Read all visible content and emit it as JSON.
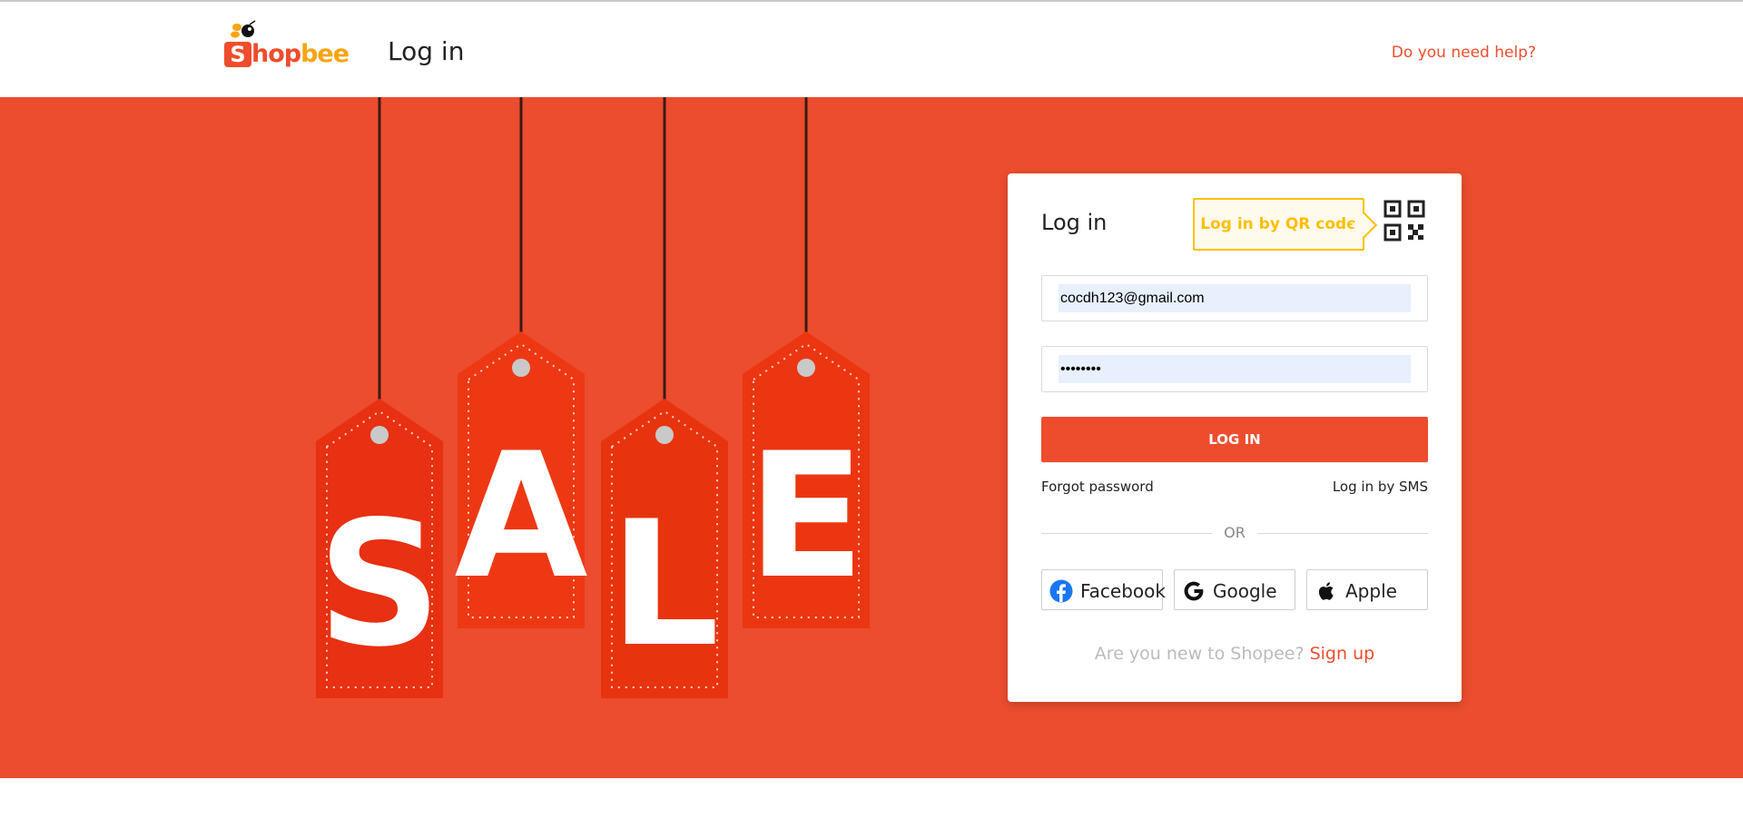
{
  "header": {
    "logo_letter": "S",
    "logo_brand_main": "hop",
    "logo_brand_accent": "bee",
    "title": "Log in",
    "help_link": "Do you need help?"
  },
  "banner": {
    "background_color": "#eb4d2e",
    "sale_letters": [
      "S",
      "A",
      "L",
      "E"
    ]
  },
  "login_card": {
    "title": "Log in",
    "qr_tooltip": "Log in by QR code",
    "email_value": "cocdh123@gmail.com",
    "password_value": "••••••••",
    "login_button": "LOG IN",
    "forgot_password": "Forgot password",
    "sms_login": "Log in by SMS",
    "divider_text": "OR",
    "social": [
      {
        "label": "Facebook",
        "icon": "facebook-icon"
      },
      {
        "label": "Google",
        "icon": "google-icon"
      },
      {
        "label": "Apple",
        "icon": "apple-icon"
      }
    ],
    "new_user_text": "Are you new to Shopee?",
    "signup_link": "Sign up"
  },
  "colors": {
    "brand": "#ee4d2d",
    "qr_accent": "#ffbf00",
    "autofill_bg": "#e8f0fe"
  }
}
